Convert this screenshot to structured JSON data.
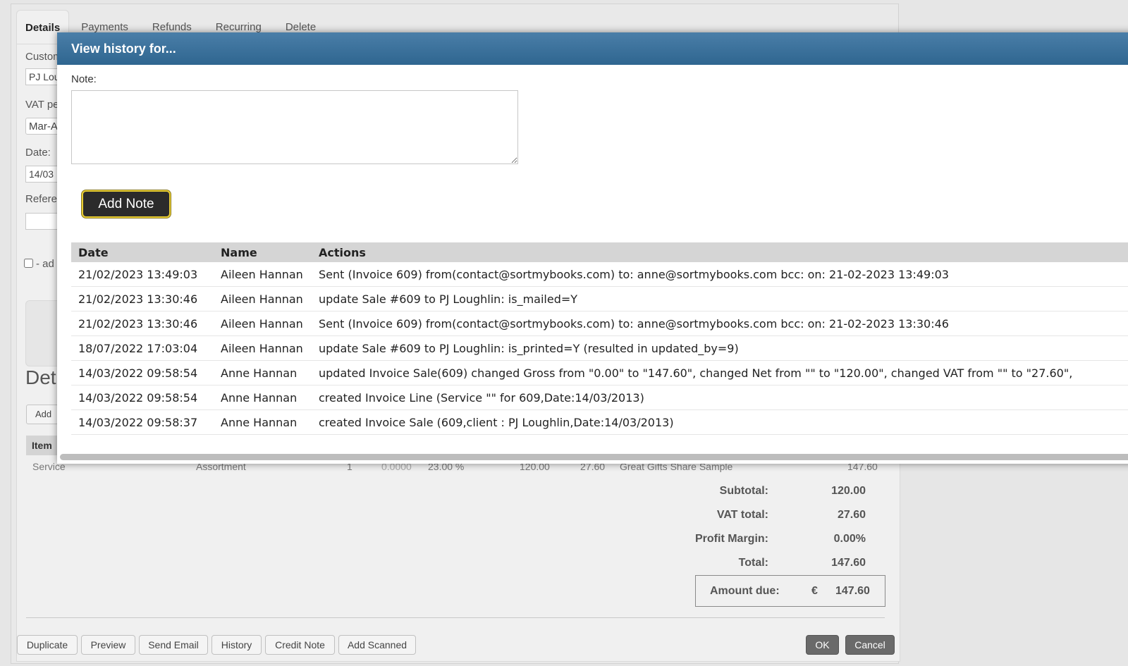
{
  "background": {
    "tabs": [
      "Details",
      "Payments",
      "Refunds",
      "Recurring",
      "Delete"
    ],
    "fields": {
      "customer_label": "Custom",
      "customer_value": "PJ Lou",
      "vat_label": "VAT pe",
      "vat_value": "Mar-A",
      "date_label": "Date:",
      "date_value": "14/03",
      "reference_label": "Refere",
      "checkbox_label": "- ad"
    },
    "details_heading": "Det",
    "add_button": "Add",
    "items_header": "Item",
    "item_row": {
      "item": "Service",
      "description": "Assortment",
      "qty": "1",
      "discount": "0.0000",
      "vat_rate": "23.00 %",
      "net": "120.00",
      "vat": "27.60",
      "note": "Great Gifts Share Sample",
      "total": "147.60"
    },
    "totals": {
      "subtotal_label": "Subtotal:",
      "subtotal_value": "120.00",
      "vat_total_label": "VAT total:",
      "vat_total_value": "27.60",
      "profit_margin_label": "Profit Margin:",
      "profit_margin_value": "0.00%",
      "total_label": "Total:",
      "total_value": "147.60",
      "amount_due_label": "Amount due:",
      "amount_due_currency": "€",
      "amount_due_value": "147.60"
    },
    "footer_buttons": [
      "Duplicate",
      "Preview",
      "Send Email",
      "History",
      "Credit Note",
      "Add Scanned"
    ],
    "ok_label": "OK",
    "cancel_label": "Cancel"
  },
  "modal": {
    "title": "View history for...",
    "note_label": "Note:",
    "note_value": "",
    "add_note_label": "Add Note",
    "columns": [
      "Date",
      "Name",
      "Actions"
    ],
    "rows": [
      {
        "date": "21/02/2023 13:49:03",
        "name": "Aileen Hannan",
        "action": "Sent (Invoice 609) from(contact@sortmybooks.com) to: anne@sortmybooks.com bcc: on: 21-02-2023 13:49:03"
      },
      {
        "date": "21/02/2023 13:30:46",
        "name": "Aileen Hannan",
        "action": "update Sale #609 to PJ Loughlin: is_mailed=Y"
      },
      {
        "date": "21/02/2023 13:30:46",
        "name": "Aileen Hannan",
        "action": "Sent (Invoice 609) from(contact@sortmybooks.com) to: anne@sortmybooks.com bcc: on: 21-02-2023 13:30:46"
      },
      {
        "date": "18/07/2022 17:03:04",
        "name": "Aileen Hannan",
        "action": "update Sale #609 to PJ Loughlin: is_printed=Y (resulted in updated_by=9)"
      },
      {
        "date": "14/03/2022 09:58:54",
        "name": "Anne Hannan",
        "action": "updated Invoice Sale(609) changed Gross from \"0.00\" to \"147.60\", changed Net from \"\" to \"120.00\", changed VAT from \"\" to \"27.60\","
      },
      {
        "date": "14/03/2022 09:58:54",
        "name": "Anne Hannan",
        "action": "created Invoice Line (Service \"\" for 609,Date:14/03/2013)"
      },
      {
        "date": "14/03/2022 09:58:37",
        "name": "Anne Hannan",
        "action": "created Invoice Sale (609,client : PJ Loughlin,Date:14/03/2013)"
      }
    ]
  }
}
